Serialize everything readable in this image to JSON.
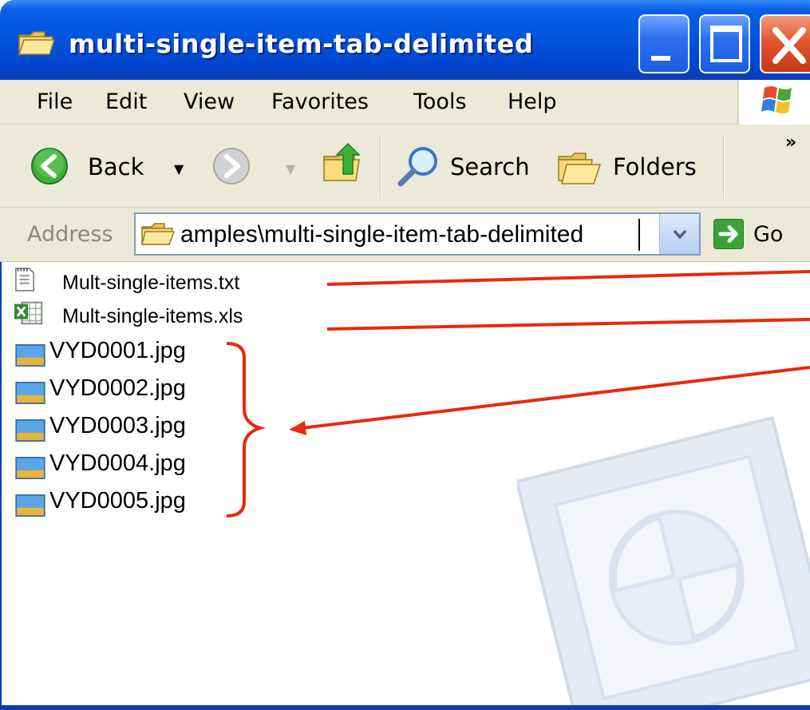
{
  "window": {
    "title": "multi-single-item-tab-delimited"
  },
  "menu": {
    "items": [
      "File",
      "Edit",
      "View",
      "Favorites",
      "Tools",
      "Help"
    ]
  },
  "toolbar": {
    "back_label": "Back",
    "search_label": "Search",
    "folders_label": "Folders",
    "overflow_label": "»"
  },
  "address": {
    "label": "Address",
    "value": "amples\\multi-single-item-tab-delimited",
    "go_label": "Go"
  },
  "files": [
    {
      "name": "Mult-single-items.txt",
      "type": "text-document"
    },
    {
      "name": "Mult-single-items.xls",
      "type": "excel-spreadsheet"
    },
    {
      "name": "VYD0001.jpg",
      "type": "jpeg-image"
    },
    {
      "name": "VYD0002.jpg",
      "type": "jpeg-image"
    },
    {
      "name": "VYD0003.jpg",
      "type": "jpeg-image"
    },
    {
      "name": "VYD0004.jpg",
      "type": "jpeg-image"
    },
    {
      "name": "VYD0005.jpg",
      "type": "jpeg-image"
    }
  ],
  "colors": {
    "titlebar_blue": "#0255dc",
    "annotation_red": "#e8290c",
    "chrome_beige": "#ece9d8"
  }
}
